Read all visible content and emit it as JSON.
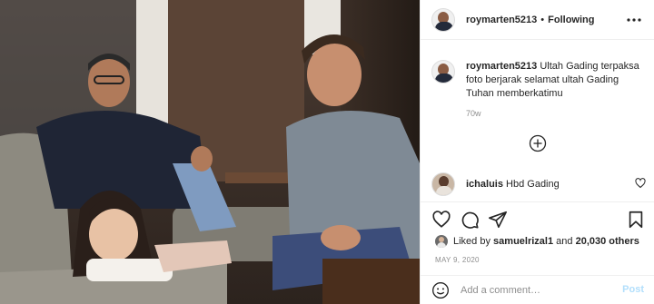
{
  "post": {
    "username": "roymarten5213",
    "follow_status": "Following",
    "separator": "•",
    "caption_user": "roymarten5213",
    "caption_text": "Ultah Gading terpaksa foto berjarak selamat ultah Gading Tuhan memberkatimu",
    "caption_time": "70w",
    "comments": [
      {
        "user": "ichaluis",
        "text": "Hbd Gading"
      }
    ],
    "likes": {
      "prefix": "Liked by",
      "user": "samuelrizal1",
      "joiner": "and",
      "count": "20,030 others"
    },
    "date": "MAY 9, 2020",
    "add_comment_placeholder": "Add a comment…",
    "post_label": "Post"
  },
  "icons": {
    "more": "more-horizontal-icon",
    "load_more": "plus-circle-icon",
    "like": "heart-icon",
    "comment": "comment-icon",
    "share": "paper-plane-icon",
    "save": "bookmark-icon",
    "emoji": "smile-icon"
  },
  "colors": {
    "text": "#262626",
    "muted": "#8e8e8e",
    "border": "#efefef",
    "post_button": "#b2dffc"
  }
}
